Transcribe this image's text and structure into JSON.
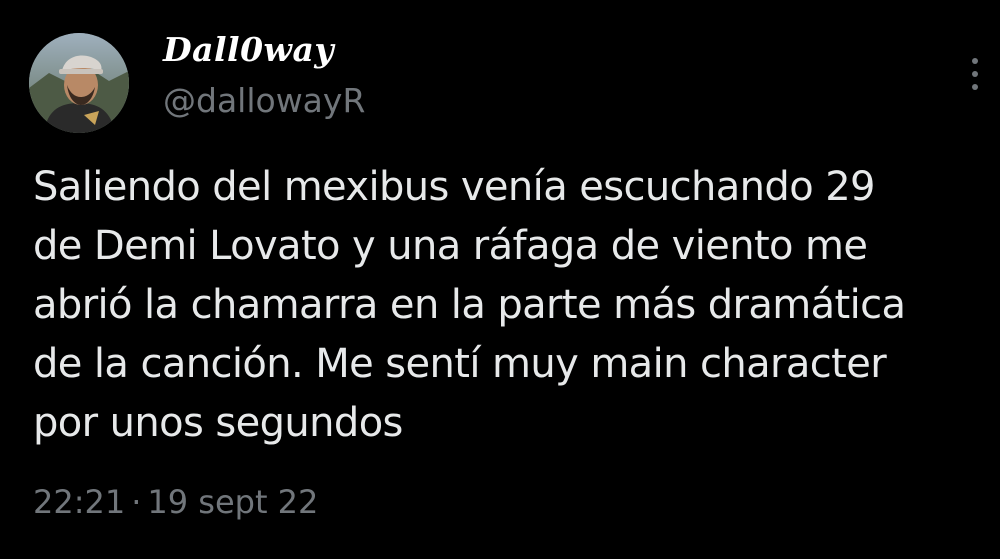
{
  "author": {
    "display_name": "Dall0way",
    "handle": "@dallowayR",
    "avatar_icon": "user-avatar-photo"
  },
  "menu": {
    "icon": "vertical-ellipsis-icon"
  },
  "tweet": {
    "lines": [
      "Saliendo del mexibus venía escuchando 29",
      "de Demi Lovato y una ráfaga de viento me",
      "abrió la chamarra en la parte más dramática",
      "de la canción. Me sentí muy main character",
      "por unos segundos"
    ],
    "time": "22:21",
    "separator": "·",
    "date": "19 sept 22"
  },
  "colors": {
    "background": "#000000",
    "text_primary": "#e7e9ea",
    "text_secondary": "#71767b"
  }
}
